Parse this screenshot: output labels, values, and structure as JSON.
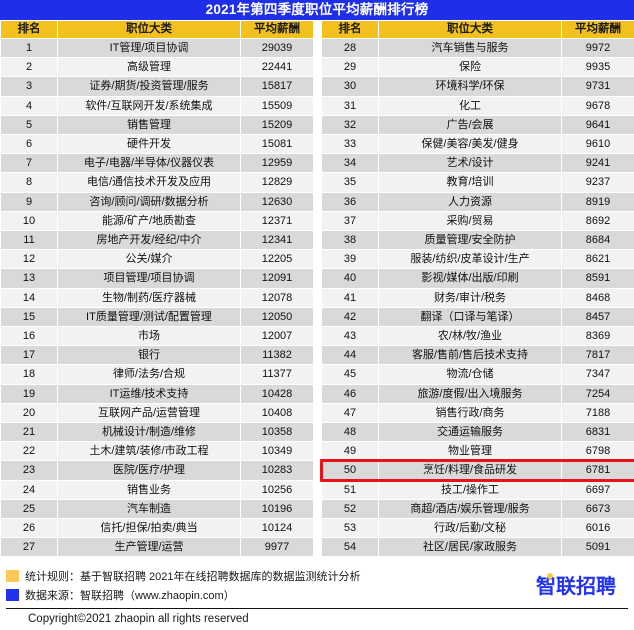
{
  "title": "2021年第四季度职位平均薪酬排行榜",
  "theme": {
    "title_bg": "#1f2ee8",
    "header_bg": "#f2c11e",
    "row_odd_bg": "#d9d9d9",
    "row_even_bg": "#f2f2f2",
    "highlight_border": "#e8131a",
    "brand_color": "#2233ee",
    "swatch_yellow": "#fac858",
    "swatch_blue": "#2233ee"
  },
  "columns": {
    "rank": "排名",
    "category": "职位大类",
    "salary": "平均薪酬"
  },
  "chart_data": {
    "type": "table",
    "title": "2021年第四季度职位平均薪酬排行榜",
    "columns": [
      "排名",
      "职位大类",
      "平均薪酬"
    ],
    "xlabel": "职位大类",
    "ylabel": "平均薪酬",
    "highlight_rank": 50,
    "rows_left": [
      {
        "rank": "1",
        "category": "IT管理/项目协调",
        "salary": "29039"
      },
      {
        "rank": "2",
        "category": "高级管理",
        "salary": "22441"
      },
      {
        "rank": "3",
        "category": "证券/期货/投资管理/服务",
        "salary": "15817"
      },
      {
        "rank": "4",
        "category": "软件/互联网开发/系统集成",
        "salary": "15509"
      },
      {
        "rank": "5",
        "category": "销售管理",
        "salary": "15209"
      },
      {
        "rank": "6",
        "category": "硬件开发",
        "salary": "15081"
      },
      {
        "rank": "7",
        "category": "电子/电器/半导体/仪器仪表",
        "salary": "12959"
      },
      {
        "rank": "8",
        "category": "电信/通信技术开发及应用",
        "salary": "12829"
      },
      {
        "rank": "9",
        "category": "咨询/顾问/调研/数据分析",
        "salary": "12630"
      },
      {
        "rank": "10",
        "category": "能源/矿产/地质勘查",
        "salary": "12371"
      },
      {
        "rank": "11",
        "category": "房地产开发/经纪/中介",
        "salary": "12341"
      },
      {
        "rank": "12",
        "category": "公关/媒介",
        "salary": "12205"
      },
      {
        "rank": "13",
        "category": "项目管理/项目协调",
        "salary": "12091"
      },
      {
        "rank": "14",
        "category": "生物/制药/医疗器械",
        "salary": "12078"
      },
      {
        "rank": "15",
        "category": "IT质量管理/测试/配置管理",
        "salary": "12050"
      },
      {
        "rank": "16",
        "category": "市场",
        "salary": "12007"
      },
      {
        "rank": "17",
        "category": "银行",
        "salary": "11382"
      },
      {
        "rank": "18",
        "category": "律师/法务/合规",
        "salary": "11377"
      },
      {
        "rank": "19",
        "category": "IT运维/技术支持",
        "salary": "10428"
      },
      {
        "rank": "20",
        "category": "互联网产品/运营管理",
        "salary": "10408"
      },
      {
        "rank": "21",
        "category": "机械设计/制造/维修",
        "salary": "10358"
      },
      {
        "rank": "22",
        "category": "土木/建筑/装修/市政工程",
        "salary": "10349"
      },
      {
        "rank": "23",
        "category": "医院/医疗/护理",
        "salary": "10283"
      },
      {
        "rank": "24",
        "category": "销售业务",
        "salary": "10256"
      },
      {
        "rank": "25",
        "category": "汽车制造",
        "salary": "10196"
      },
      {
        "rank": "26",
        "category": "信托/担保/拍卖/典当",
        "salary": "10124"
      },
      {
        "rank": "27",
        "category": "生产管理/运营",
        "salary": "9977"
      }
    ],
    "rows_right": [
      {
        "rank": "28",
        "category": "汽车销售与服务",
        "salary": "9972"
      },
      {
        "rank": "29",
        "category": "保险",
        "salary": "9935"
      },
      {
        "rank": "30",
        "category": "环境科学/环保",
        "salary": "9731"
      },
      {
        "rank": "31",
        "category": "化工",
        "salary": "9678"
      },
      {
        "rank": "32",
        "category": "广告/会展",
        "salary": "9641"
      },
      {
        "rank": "33",
        "category": "保健/美容/美发/健身",
        "salary": "9610"
      },
      {
        "rank": "34",
        "category": "艺术/设计",
        "salary": "9241"
      },
      {
        "rank": "35",
        "category": "教育/培训",
        "salary": "9237"
      },
      {
        "rank": "36",
        "category": "人力资源",
        "salary": "8919"
      },
      {
        "rank": "37",
        "category": "采购/贸易",
        "salary": "8692"
      },
      {
        "rank": "38",
        "category": "质量管理/安全防护",
        "salary": "8684"
      },
      {
        "rank": "39",
        "category": "服装/纺织/皮革设计/生产",
        "salary": "8621"
      },
      {
        "rank": "40",
        "category": "影视/媒体/出版/印刷",
        "salary": "8591"
      },
      {
        "rank": "41",
        "category": "财务/审计/税务",
        "salary": "8468"
      },
      {
        "rank": "42",
        "category": "翻译（口译与笔译）",
        "salary": "8457"
      },
      {
        "rank": "43",
        "category": "农/林/牧/渔业",
        "salary": "8369"
      },
      {
        "rank": "44",
        "category": "客服/售前/售后技术支持",
        "salary": "7817"
      },
      {
        "rank": "45",
        "category": "物流/仓储",
        "salary": "7347"
      },
      {
        "rank": "46",
        "category": "旅游/度假/出入境服务",
        "salary": "7254"
      },
      {
        "rank": "47",
        "category": "销售行政/商务",
        "salary": "7188"
      },
      {
        "rank": "48",
        "category": "交通运输服务",
        "salary": "6831"
      },
      {
        "rank": "49",
        "category": "物业管理",
        "salary": "6798"
      },
      {
        "rank": "50",
        "category": "烹饪/料理/食品研发",
        "salary": "6781"
      },
      {
        "rank": "51",
        "category": "技工/操作工",
        "salary": "6697"
      },
      {
        "rank": "52",
        "category": "商超/酒店/娱乐管理/服务",
        "salary": "6673"
      },
      {
        "rank": "53",
        "category": "行政/后勤/文秘",
        "salary": "6016"
      },
      {
        "rank": "54",
        "category": "社区/居民/家政服务",
        "salary": "5091"
      }
    ]
  },
  "footer": {
    "note_rule": "统计规则：基于智联招聘  2021年在线招聘数据库的数据监测统计分析",
    "note_source": "数据来源：智联招聘（www.zhaopin.com）",
    "brand": "智联招聘",
    "copyright": "Copyright©2021 zhaopin all rights reserved"
  }
}
